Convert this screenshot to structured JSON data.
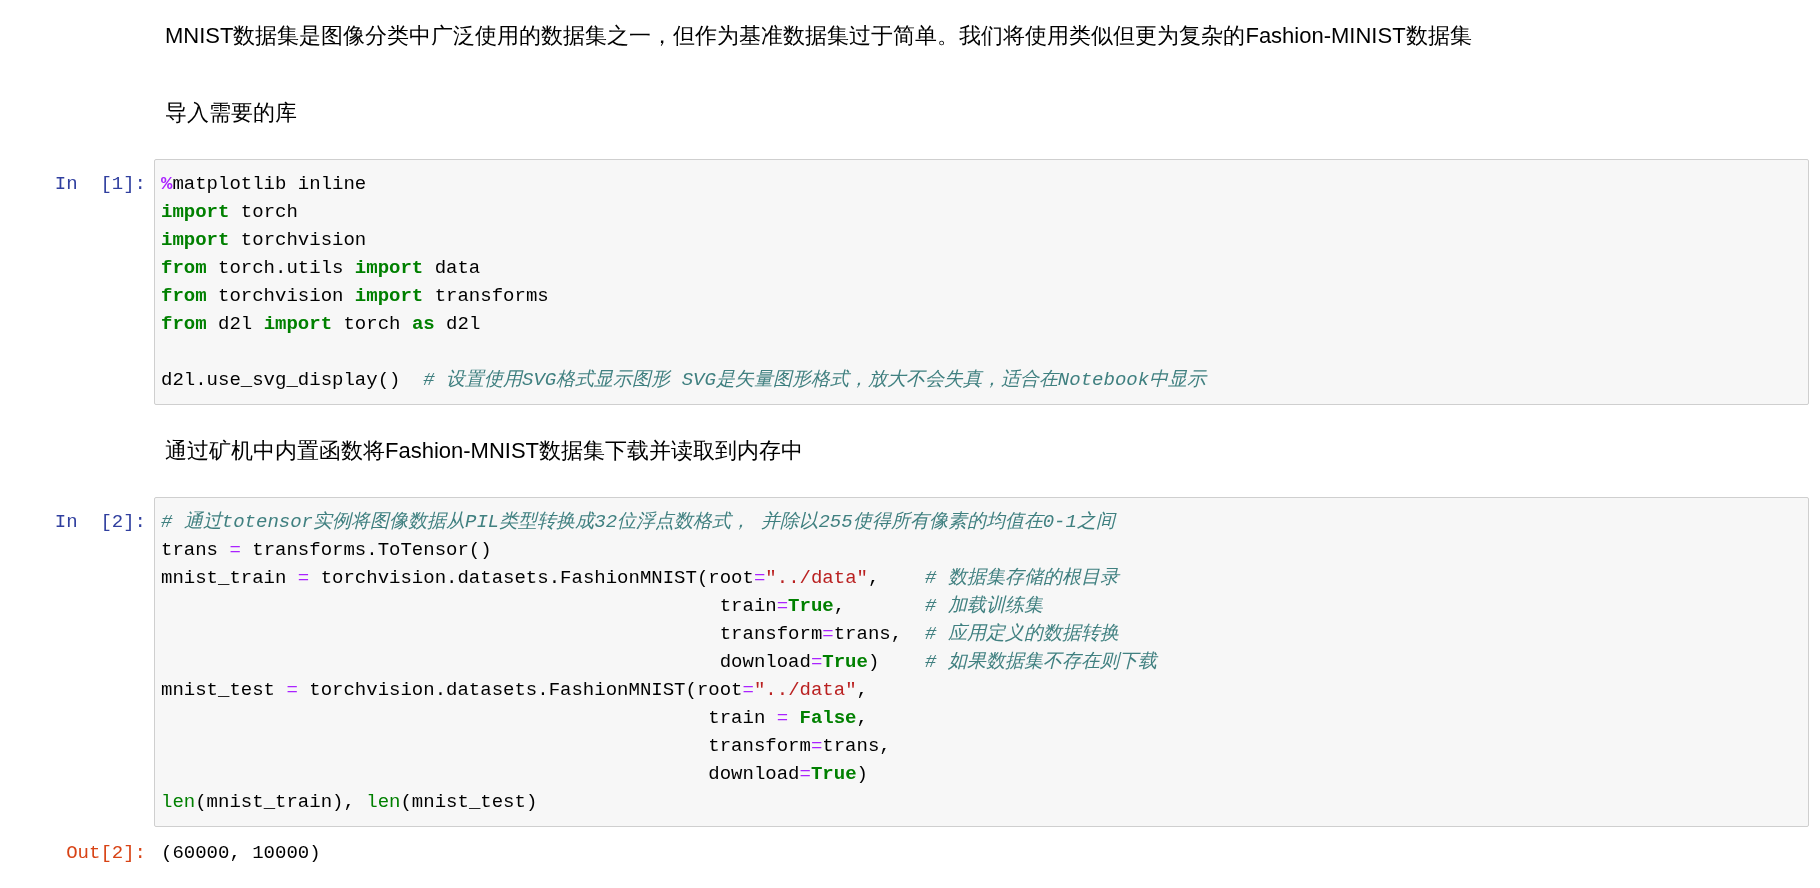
{
  "cells": [
    {
      "kind": "markdown",
      "text": "MNIST数据集是图像分类中广泛使用的数据集之一，但作为基准数据集过于简单。我们将使用类似但更为复杂的Fashion-MINIST数据集"
    },
    {
      "kind": "markdown",
      "text": "导入需要的库"
    },
    {
      "kind": "code",
      "prompt": "In  [1]:",
      "lines": [
        {
          "segments": [
            {
              "text": "%",
              "kind": "magic"
            },
            {
              "text": "matplotlib inline",
              "kind": "plain"
            }
          ]
        },
        {
          "segments": [
            {
              "text": "import",
              "kind": "keyword"
            },
            {
              "text": " torch",
              "kind": "plain"
            }
          ]
        },
        {
          "segments": [
            {
              "text": "import",
              "kind": "keyword"
            },
            {
              "text": " torchvision",
              "kind": "plain"
            }
          ]
        },
        {
          "segments": [
            {
              "text": "from",
              "kind": "keyword"
            },
            {
              "text": " torch.utils ",
              "kind": "plain"
            },
            {
              "text": "import",
              "kind": "keyword"
            },
            {
              "text": " data",
              "kind": "plain"
            }
          ]
        },
        {
          "segments": [
            {
              "text": "from",
              "kind": "keyword"
            },
            {
              "text": " torchvision ",
              "kind": "plain"
            },
            {
              "text": "import",
              "kind": "keyword"
            },
            {
              "text": " transforms",
              "kind": "plain"
            }
          ]
        },
        {
          "segments": [
            {
              "text": "from",
              "kind": "keyword"
            },
            {
              "text": " d2l ",
              "kind": "plain"
            },
            {
              "text": "import",
              "kind": "keyword"
            },
            {
              "text": " torch ",
              "kind": "plain"
            },
            {
              "text": "as",
              "kind": "keyword"
            },
            {
              "text": " d2l",
              "kind": "plain"
            }
          ]
        },
        {
          "kind": "blank"
        },
        {
          "segments": [
            {
              "text": "d2l.use_svg_display()  ",
              "kind": "plain"
            },
            {
              "text": "# 设置使用SVG格式显示图形 SVG是矢量图形格式，放大不会失真，适合在Notebook中显示",
              "kind": "comment"
            }
          ]
        }
      ]
    },
    {
      "kind": "markdown",
      "text": "通过矿机中内置函数将Fashion-MNIST数据集下载并读取到内存中"
    },
    {
      "kind": "code",
      "prompt": "In  [2]:",
      "lines": [
        {
          "segments": [
            {
              "text": "# 通过totensor实例将图像数据从PIL类型转换成32位浮点数格式， 并除以255使得所有像素的均值在0-1之间",
              "kind": "comment"
            }
          ]
        },
        {
          "segments": [
            {
              "text": "trans ",
              "kind": "plain"
            },
            {
              "text": "=",
              "kind": "operator"
            },
            {
              "text": " transforms.ToTensor()",
              "kind": "plain"
            }
          ]
        },
        {
          "segments": [
            {
              "text": "mnist_train ",
              "kind": "plain"
            },
            {
              "text": "=",
              "kind": "operator"
            },
            {
              "text": " torchvision.datasets.FashionMNIST(root",
              "kind": "plain"
            },
            {
              "text": "=",
              "kind": "operator"
            },
            {
              "text": "\"../data\"",
              "kind": "string"
            },
            {
              "text": ",    ",
              "kind": "plain"
            },
            {
              "text": "# 数据集存储的根目录",
              "kind": "comment"
            }
          ]
        },
        {
          "segments": [
            {
              "text": "                                                 train",
              "kind": "plain"
            },
            {
              "text": "=",
              "kind": "operator"
            },
            {
              "text": "True",
              "kind": "keyword"
            },
            {
              "text": ",       ",
              "kind": "plain"
            },
            {
              "text": "# 加载训练集",
              "kind": "comment"
            }
          ]
        },
        {
          "segments": [
            {
              "text": "                                                 transform",
              "kind": "plain"
            },
            {
              "text": "=",
              "kind": "operator"
            },
            {
              "text": "trans,  ",
              "kind": "plain"
            },
            {
              "text": "# 应用定义的数据转换",
              "kind": "comment"
            }
          ]
        },
        {
          "segments": [
            {
              "text": "                                                 download",
              "kind": "plain"
            },
            {
              "text": "=",
              "kind": "operator"
            },
            {
              "text": "True",
              "kind": "keyword"
            },
            {
              "text": ")    ",
              "kind": "plain"
            },
            {
              "text": "# 如果数据集不存在则下载",
              "kind": "comment"
            }
          ]
        },
        {
          "segments": [
            {
              "text": "mnist_test ",
              "kind": "plain"
            },
            {
              "text": "=",
              "kind": "operator"
            },
            {
              "text": " torchvision.datasets.FashionMNIST(root",
              "kind": "plain"
            },
            {
              "text": "=",
              "kind": "operator"
            },
            {
              "text": "\"../data\"",
              "kind": "string"
            },
            {
              "text": ",",
              "kind": "plain"
            }
          ]
        },
        {
          "segments": [
            {
              "text": "                                                train ",
              "kind": "plain"
            },
            {
              "text": "=",
              "kind": "operator"
            },
            {
              "text": " False",
              "kind": "keyword"
            },
            {
              "text": ",",
              "kind": "plain"
            }
          ]
        },
        {
          "segments": [
            {
              "text": "                                                transform",
              "kind": "plain"
            },
            {
              "text": "=",
              "kind": "operator"
            },
            {
              "text": "trans,",
              "kind": "plain"
            }
          ]
        },
        {
          "segments": [
            {
              "text": "                                                download",
              "kind": "plain"
            },
            {
              "text": "=",
              "kind": "operator"
            },
            {
              "text": "True",
              "kind": "keyword"
            },
            {
              "text": ")",
              "kind": "plain"
            }
          ]
        },
        {
          "segments": [
            {
              "text": "len",
              "kind": "builtin"
            },
            {
              "text": "(mnist_train), ",
              "kind": "plain"
            },
            {
              "text": "len",
              "kind": "builtin"
            },
            {
              "text": "(mnist_test)",
              "kind": "plain"
            }
          ]
        }
      ]
    },
    {
      "kind": "output",
      "prompt": "Out[2]:",
      "text": "(60000, 10000)"
    }
  ]
}
